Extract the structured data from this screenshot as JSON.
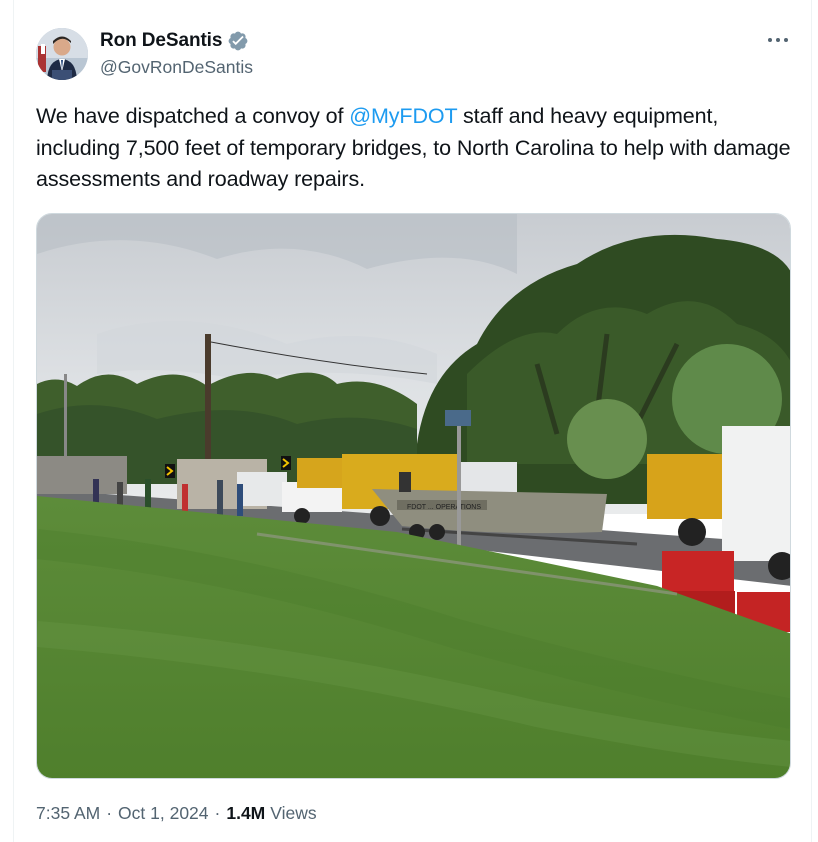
{
  "author": {
    "display_name": "Ron DeSantis",
    "handle": "@GovRonDeSantis",
    "verified": true,
    "verified_icon": "verified-badge-icon"
  },
  "more_icon": "more-dots-icon",
  "tweet": {
    "text_before": "We have dispatched a convoy of ",
    "mention": "@MyFDOT",
    "text_after": " staff and heavy equipment, including 7,500 feet of temporary bridges, to North Carolina to help with damage assessments and roadway repairs."
  },
  "media": {
    "boat_lettering": "FDOT ... OPERATIONS"
  },
  "meta": {
    "time": "7:35 AM",
    "date": "Oct 1, 2024",
    "separator": "·",
    "views_count": "1.4M",
    "views_label": "Views"
  },
  "colors": {
    "link": "#1d9bf0",
    "text": "#0f1419",
    "secondary": "#536471",
    "verified_badge": "#829aab"
  }
}
